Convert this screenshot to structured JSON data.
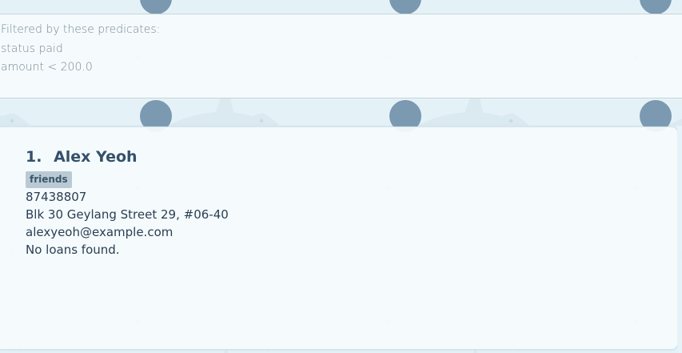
{
  "result_display": {
    "lines": [
      "Filtered by these predicates:",
      "status paid",
      "amount < 200.0"
    ]
  },
  "person_list": {
    "cards": [
      {
        "index": "1.",
        "name": "Alex Yeoh",
        "tags": [
          "friends"
        ],
        "phone": "87438807",
        "address": "Blk 30 Geylang Street 29, #06-40",
        "email": "alexyeoh@example.com",
        "loans": "No loans found."
      }
    ]
  },
  "background": {
    "motif": "shark-pattern-icon",
    "colors": {
      "band": "#e4f2f8",
      "panel": "#f6fcfd",
      "shark": "#d7e7ed",
      "tag": "#b9cad5",
      "title": "#34506a"
    }
  }
}
